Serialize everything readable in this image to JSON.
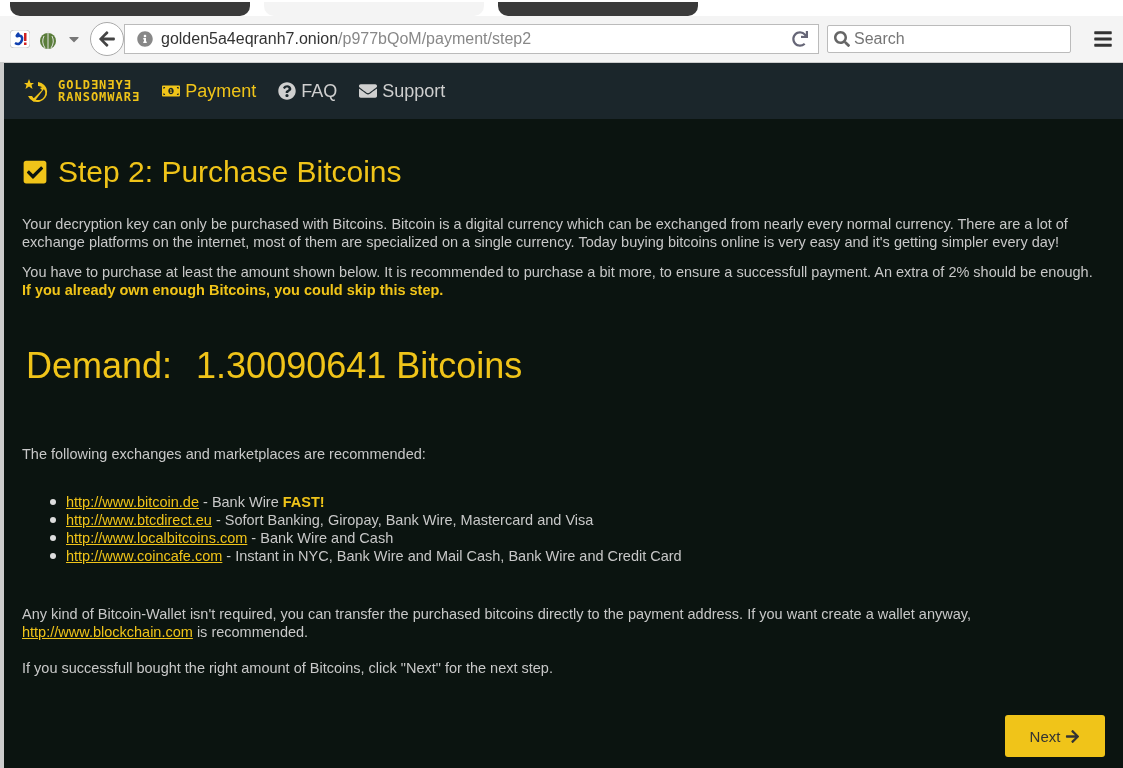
{
  "browser": {
    "tabs": [
      {
        "selected": false
      },
      {
        "selected": true
      },
      {
        "selected": false
      }
    ],
    "url_host": "golden5a4eqranh7.onion",
    "url_path": "/p977bQoM/payment/step2",
    "search": {
      "placeholder": "Search"
    }
  },
  "site": {
    "logo": [
      "GOLDƎNƎYƎ",
      "RANSOMWARƎ"
    ],
    "nav": [
      {
        "label": "Payment",
        "selected": true
      },
      {
        "label": "FAQ",
        "selected": false
      },
      {
        "label": "Support",
        "selected": false
      }
    ]
  },
  "heading": "Step 2: Purchase Bitcoins",
  "paragraphs": [
    "Your decryption key can only be purchased with Bitcoins. Bitcoin is a digital currency which can be exchanged from nearly every normal currency. There are a lot of exchange platforms on the internet, most of them are specialized on a single currency. Today buying bitcoins online is very easy and it's getting simpler every day!",
    "You have to purchase at least the amount shown below. It is recommended to purchase a bit more, to ensure a successfull payment. An extra of 2% should be enough. **If you already own enough Bitcoins, you could skip this step.**"
  ],
  "demand": {
    "label": "Demand:",
    "amount": "1.30090641 Bitcoins"
  },
  "exchanges_intro": "The following exchanges and marketplaces are recommended:",
  "exchanges": [
    {
      "link": "http://www.bitcoin.de",
      "text": " - Bank Wire **FAST!**"
    },
    {
      "link": "http://www.btcdirect.eu",
      "text": " - Sofort Banking, Giropay, Bank Wire, Mastercard and Visa"
    },
    {
      "link": "http://www.localbitcoins.com",
      "text": " - Bank Wire and Cash"
    },
    {
      "link": "http://www.coincafe.com",
      "text": " - Instant in NYC, Bank Wire and Mail Cash, Bank Wire and Credit Card"
    }
  ],
  "wallet_note": {
    "text": "Any kind of Bitcoin-Wallet isn't required, you can transfer the purchased bitcoins directly to the payment address. If you want create a wallet anyway,",
    "link": "http://www.blockchain.com",
    "after": " is recommended."
  },
  "final_note": "If you successfull bought the right amount of Bitcoins, click \"Next\" for the next step.",
  "next_button": "Next"
}
